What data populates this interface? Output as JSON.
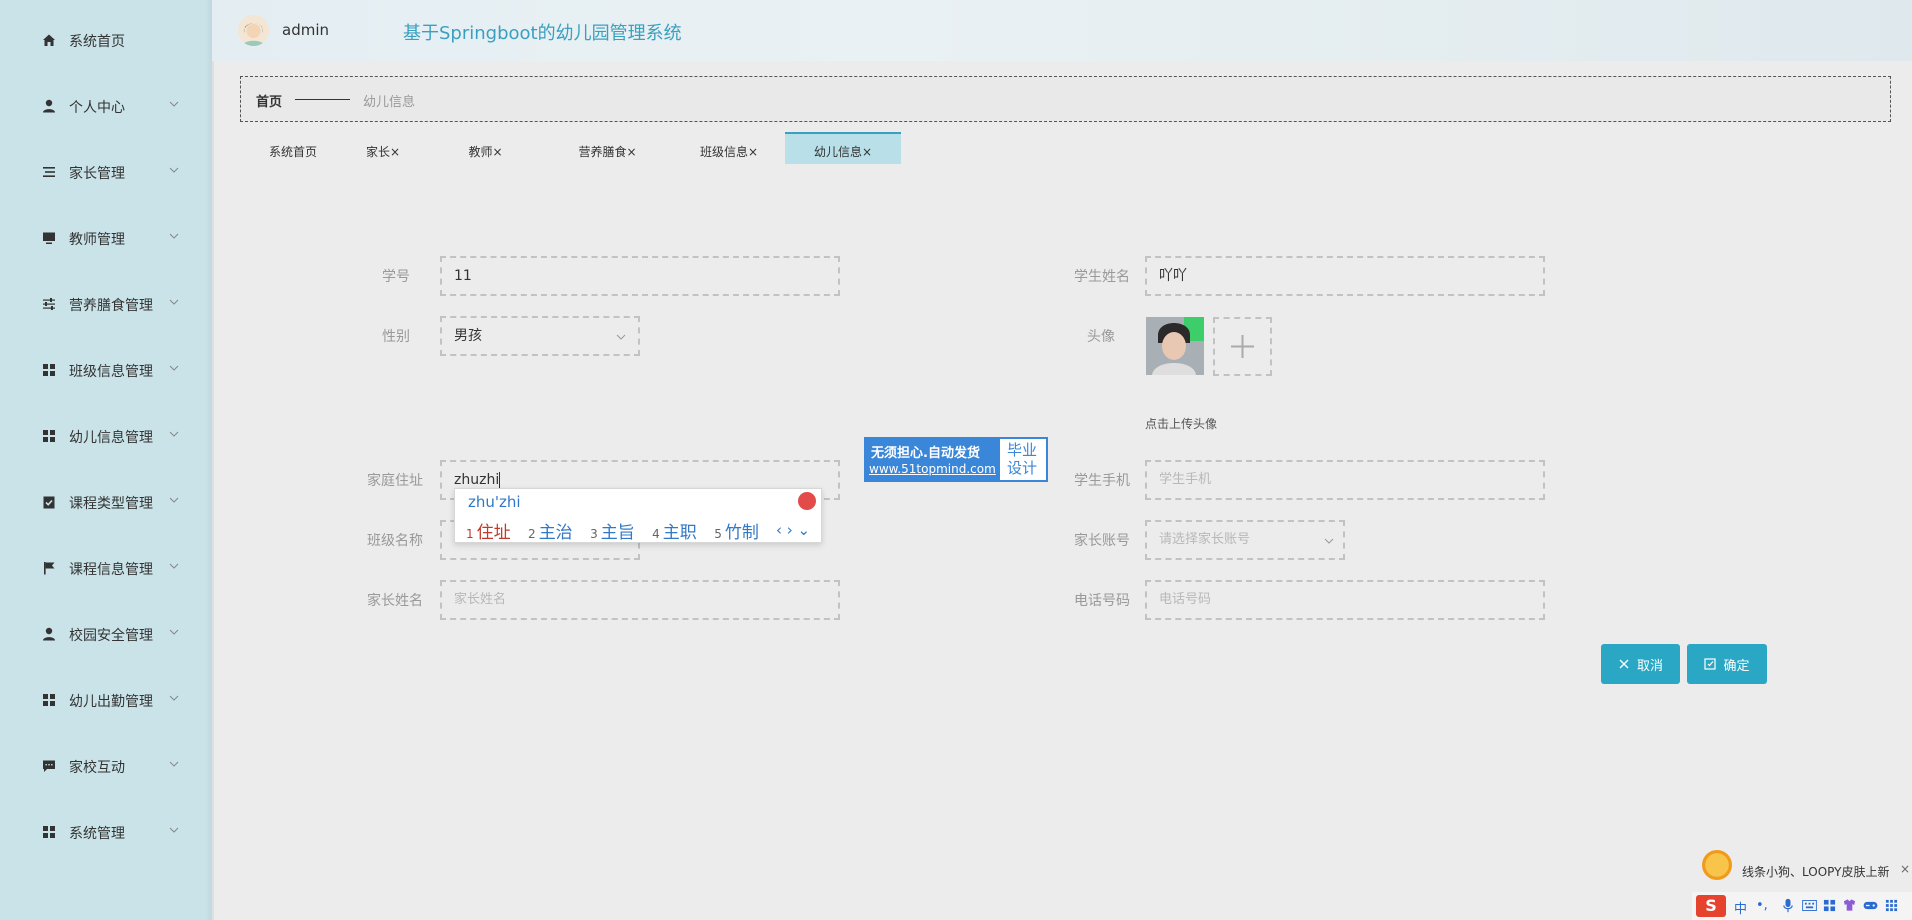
{
  "app": {
    "title": "基于Springboot的幼儿园管理系统",
    "username": "admin"
  },
  "sidebar": {
    "items": [
      {
        "label": "系统首页",
        "icon": "home-icon",
        "has_children": false
      },
      {
        "label": "个人中心",
        "icon": "user-icon",
        "has_children": true
      },
      {
        "label": "家长管理",
        "icon": "list-icon",
        "has_children": true
      },
      {
        "label": "教师管理",
        "icon": "monitor-icon",
        "has_children": true
      },
      {
        "label": "营养膳食管理",
        "icon": "sliders-icon",
        "has_children": true
      },
      {
        "label": "班级信息管理",
        "icon": "grid-icon",
        "has_children": true
      },
      {
        "label": "幼儿信息管理",
        "icon": "grid-icon",
        "has_children": true
      },
      {
        "label": "课程类型管理",
        "icon": "clipboard-check-icon",
        "has_children": true
      },
      {
        "label": "课程信息管理",
        "icon": "flag-icon",
        "has_children": true
      },
      {
        "label": "校园安全管理",
        "icon": "user-icon",
        "has_children": true
      },
      {
        "label": "幼儿出勤管理",
        "icon": "grid-icon",
        "has_children": true
      },
      {
        "label": "家校互动",
        "icon": "chat-icon",
        "has_children": true
      },
      {
        "label": "系统管理",
        "icon": "grid-icon",
        "has_children": true
      }
    ]
  },
  "breadcrumb": {
    "home": "首页",
    "current": "幼儿信息"
  },
  "tabs": [
    {
      "label": "系统首页",
      "closable": false,
      "active": false
    },
    {
      "label": "家长",
      "closable": true,
      "active": false
    },
    {
      "label": "教师",
      "closable": true,
      "active": false
    },
    {
      "label": "营养膳食",
      "closable": true,
      "active": false
    },
    {
      "label": "班级信息",
      "closable": true,
      "active": false
    },
    {
      "label": "幼儿信息",
      "closable": true,
      "active": true
    }
  ],
  "tab_close_glyph": "×",
  "form": {
    "student_no": {
      "label": "学号",
      "value": "11"
    },
    "student_name": {
      "label": "学生姓名",
      "value": "吖吖"
    },
    "gender": {
      "label": "性别",
      "value": "男孩"
    },
    "avatar": {
      "label": "头像",
      "hint": "点击上传头像"
    },
    "address": {
      "label": "家庭住址",
      "value": "zhuzhi"
    },
    "student_phone": {
      "label": "学生手机",
      "placeholder": "学生手机"
    },
    "class_name": {
      "label": "班级名称",
      "placeholder": ""
    },
    "parent_account": {
      "label": "家长账号",
      "placeholder": "请选择家长账号"
    },
    "parent_name": {
      "label": "家长姓名",
      "placeholder": "家长姓名"
    },
    "phone": {
      "label": "电话号码",
      "placeholder": "电话号码"
    }
  },
  "buttons": {
    "cancel": "取消",
    "confirm": "确定"
  },
  "ime": {
    "pinyin": "zhu'zhi",
    "candidates": [
      {
        "n": "1",
        "text": "住址"
      },
      {
        "n": "2",
        "text": "主治"
      },
      {
        "n": "3",
        "text": "主旨"
      },
      {
        "n": "4",
        "text": "主职"
      },
      {
        "n": "5",
        "text": "竹制"
      }
    ],
    "nav": "‹ › ⌄"
  },
  "ad": {
    "line1": "无须担心.自动发货",
    "line2": "www.51topmind.com",
    "right1": "毕业",
    "right2": "设计"
  },
  "notification": {
    "text": "线条小狗、LOOPY皮肤上新",
    "close": "×"
  },
  "tray": {
    "logo": "S",
    "lang": "中",
    "symbols": "•,"
  },
  "colors": {
    "accent": "#2aa7c4",
    "sidebar_bg": "#c9e3e8",
    "title": "#3aa0c0"
  }
}
